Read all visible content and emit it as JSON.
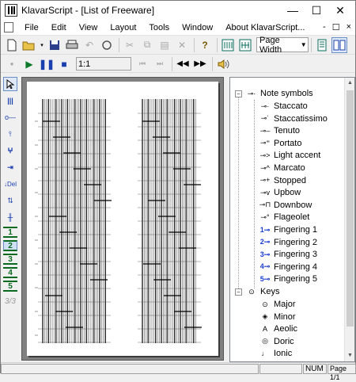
{
  "window": {
    "title": "KlavarScript - [List of Freeware]",
    "minimize_glyph": "—",
    "maximize_glyph": "☐",
    "close_glyph": "✕"
  },
  "menu": {
    "items": [
      "File",
      "Edit",
      "View",
      "Layout",
      "Tools",
      "Window",
      "About KlavarScript..."
    ],
    "right_controls": [
      "-",
      "☐",
      "×"
    ]
  },
  "toolbar": {
    "zoom_value": "Page Width"
  },
  "transport": {
    "position_value": "1:1"
  },
  "tree": {
    "note_symbols": {
      "label": "Note symbols",
      "items": [
        "Staccato",
        "Staccatissimo",
        "Tenuto",
        "Portato",
        "Light accent",
        "Marcato",
        "Stopped",
        "Upbow",
        "Downbow",
        "Flageolet",
        "Fingering 1",
        "Fingering 2",
        "Fingering 3",
        "Fingering 4",
        "Fingering 5"
      ],
      "icons": [
        "staccato-icon",
        "staccatissimo-icon",
        "tenuto-icon",
        "portato-icon",
        "light-accent-icon",
        "marcato-icon",
        "stopped-icon",
        "upbow-icon",
        "downbow-icon",
        "flageolet-icon",
        "fingering-1-icon",
        "fingering-2-icon",
        "fingering-3-icon",
        "fingering-4-icon",
        "fingering-5-icon"
      ],
      "fingering_numbers": [
        "1",
        "2",
        "3",
        "4",
        "5"
      ]
    },
    "keys": {
      "label": "Keys",
      "items": [
        "Major",
        "Minor",
        "Aeolic",
        "Doric",
        "Ionic"
      ]
    }
  },
  "status": {
    "num": "NUM",
    "page": "Page 1/1"
  },
  "colors": {
    "accent_blue": "#1a3fcf",
    "finger_green": "#0a6b1e",
    "canvas_gray": "#808080"
  }
}
